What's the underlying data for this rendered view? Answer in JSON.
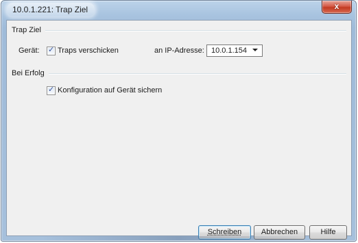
{
  "window": {
    "title": "10.0.1.221: Trap Ziel",
    "close_glyph": "x"
  },
  "sections": {
    "trap_ziel": {
      "title": "Trap Ziel",
      "geraet_label": "Gerät:",
      "traps_checkbox_label": "Traps verschicken",
      "traps_checked": true,
      "ip_label": "an IP-Adresse:",
      "ip_value": "10.0.1.154"
    },
    "bei_erfolg": {
      "title": "Bei Erfolg",
      "sichern_checkbox_label": "Konfiguration auf Gerät sichern",
      "sichern_checked": true
    }
  },
  "buttons": {
    "schreiben": "Schreiben",
    "abbrechen": "Abbrechen",
    "hilfe": "Hilfe"
  },
  "icons": {
    "check": "checkmark-icon",
    "dropdown": "chevron-down-icon",
    "close": "close-icon"
  },
  "colors": {
    "frame": "#a9c4e0",
    "client_bg": "#f0f0f0",
    "close_red": "#c33a22",
    "check_blue": "#3a57a0"
  }
}
